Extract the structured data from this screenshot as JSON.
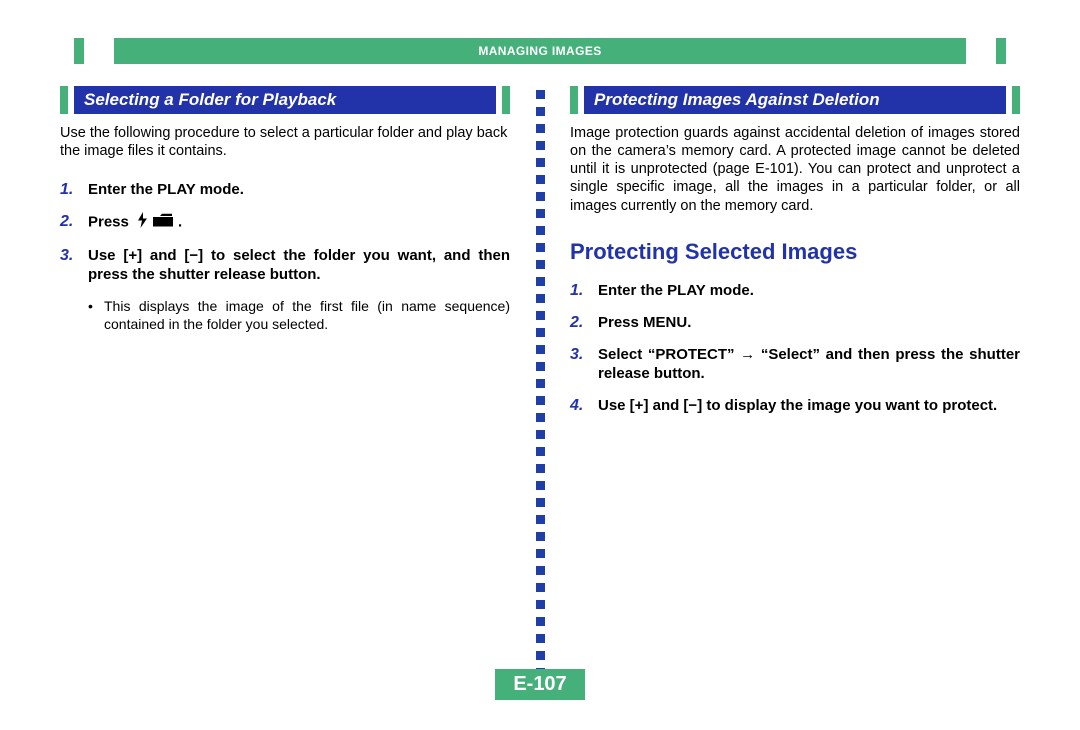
{
  "header": {
    "title": "MANAGING IMAGES"
  },
  "left": {
    "section_title": "Selecting a Folder for Playback",
    "intro": "Use the following procedure to select a particular folder and play back the image files it contains.",
    "steps": [
      {
        "num": "1.",
        "text": "Enter the PLAY mode."
      },
      {
        "num": "2.",
        "prefix": "Press",
        "suffix": ".",
        "has_icons": true
      },
      {
        "num": "3.",
        "text": "Use [+] and [−] to select the folder you want, and then press the shutter release button."
      }
    ],
    "sub_bullet": "This displays the image of the first file (in name sequence) contained in the folder you selected."
  },
  "right": {
    "section_title": "Protecting Images Against Deletion",
    "intro": "Image protection guards against accidental deletion of images stored on the camera’s memory card. A protected image cannot be deleted until it is unprotected (page E-101). You can protect and unprotect a single specific image, all the images in a particular folder, or all images currently on the memory card.",
    "subheading": "Protecting Selected Images",
    "steps": [
      {
        "num": "1.",
        "text": "Enter the PLAY mode."
      },
      {
        "num": "2.",
        "text": "Press MENU."
      },
      {
        "num": "3.",
        "text": "Select “PROTECT” → “Select” and then press the shutter release button."
      },
      {
        "num": "4.",
        "text": "Use [+] and [−] to display the image you want to protect."
      }
    ]
  },
  "page_number": "E-107"
}
